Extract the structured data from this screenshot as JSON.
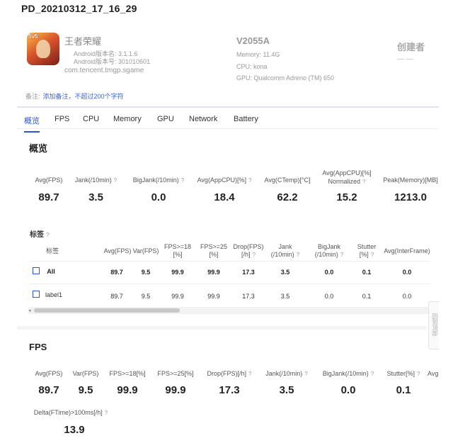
{
  "page": {
    "title": "PD_20210312_17_16_29"
  },
  "app": {
    "name": "王者荣耀",
    "icon_badge": "5v5",
    "version_label": "Android版本名: 3.1.1.6",
    "build_label": "Android版本号: 301010601",
    "package": "com.tencent.tmgp.sgame"
  },
  "device": {
    "model": "V2055A",
    "memory": "Memory: 11.4G",
    "cpu": "CPU: kona",
    "gpu": "GPU: Qualcomm Adreno (TM) 650"
  },
  "creator": {
    "label": "创建者",
    "value": "— —"
  },
  "remark": {
    "label": "备注:",
    "link": "添加备注，不超过200个字符"
  },
  "tabs": [
    "概览",
    "FPS",
    "CPU",
    "Memory",
    "GPU",
    "Network",
    "Battery"
  ],
  "overview": {
    "title": "概览",
    "stats": [
      {
        "label": "Avg(FPS)",
        "value": "89.7",
        "help": ""
      },
      {
        "label": "Jank(/10min)",
        "value": "3.5",
        "help": "?"
      },
      {
        "label": "BigJank(/10min)",
        "value": "0.0",
        "help": "?"
      },
      {
        "label": "Avg(AppCPU)[%]",
        "value": "18.4",
        "help": "?"
      },
      {
        "label": "Avg(CTemp)[°C]",
        "value": "62.2",
        "help": ""
      },
      {
        "label": "Avg(AppCPU)[%]",
        "label2": "Normalized",
        "value": "15.2",
        "help": "?"
      },
      {
        "label": "Peak(Memory)[MB]",
        "value": "1213.0",
        "help": ""
      }
    ]
  },
  "tags": {
    "title": "标签",
    "help": "?",
    "columns": [
      {
        "l1": "标签",
        "l2": ""
      },
      {
        "l1": "Avg(FPS)",
        "l2": ""
      },
      {
        "l1": "Var(FPS)",
        "l2": ""
      },
      {
        "l1": "FPS>=18",
        "l2": "[%]"
      },
      {
        "l1": "FPS>=25",
        "l2": "[%]"
      },
      {
        "l1": "Drop(FPS)",
        "l2": "[/h]",
        "help": "?"
      },
      {
        "l1": "Jank",
        "l2": "(/10min)",
        "help": "?"
      },
      {
        "l1": "BigJank",
        "l2": "(/10min)",
        "help": "?"
      },
      {
        "l1": "Stutter",
        "l2": "[%]",
        "help": "?"
      },
      {
        "l1": "Avg(InterFrame)",
        "l2": ""
      }
    ],
    "rows": [
      {
        "name": "All",
        "cells": [
          "89.7",
          "9.5",
          "99.9",
          "99.9",
          "17.3",
          "3.5",
          "0.0",
          "0.1",
          "0.0"
        ]
      },
      {
        "name": "label1",
        "cells": [
          "89.7",
          "9.5",
          "99.9",
          "99.9",
          "17.3",
          "3.5",
          "0.0",
          "0.1",
          "0.0"
        ]
      }
    ],
    "scroll_arrow": "◂"
  },
  "side_handle": {
    "text": "回到顶部"
  },
  "fps": {
    "title": "FPS",
    "stats": [
      {
        "label": "Avg(FPS)",
        "value": "89.7",
        "help": ""
      },
      {
        "label": "Var(FPS)",
        "value": "9.5",
        "help": ""
      },
      {
        "label": "FPS>=18[%]",
        "value": "99.9",
        "help": ""
      },
      {
        "label": "FPS>=25[%]",
        "value": "99.9",
        "help": ""
      },
      {
        "label": "Drop(FPS)[/h]",
        "value": "17.3",
        "help": "?"
      },
      {
        "label": "Jank(/10min)",
        "value": "3.5",
        "help": "?"
      },
      {
        "label": "BigJank(/10min)",
        "value": "0.0",
        "help": "?"
      },
      {
        "label": "Stutter[%]",
        "value": "0.1",
        "help": "?"
      },
      {
        "label": "Avg",
        "value": "",
        "help": ""
      }
    ],
    "delta": {
      "label": "Delta(FTime)>100ms[/h]",
      "value": "13.9",
      "help": "?"
    }
  }
}
